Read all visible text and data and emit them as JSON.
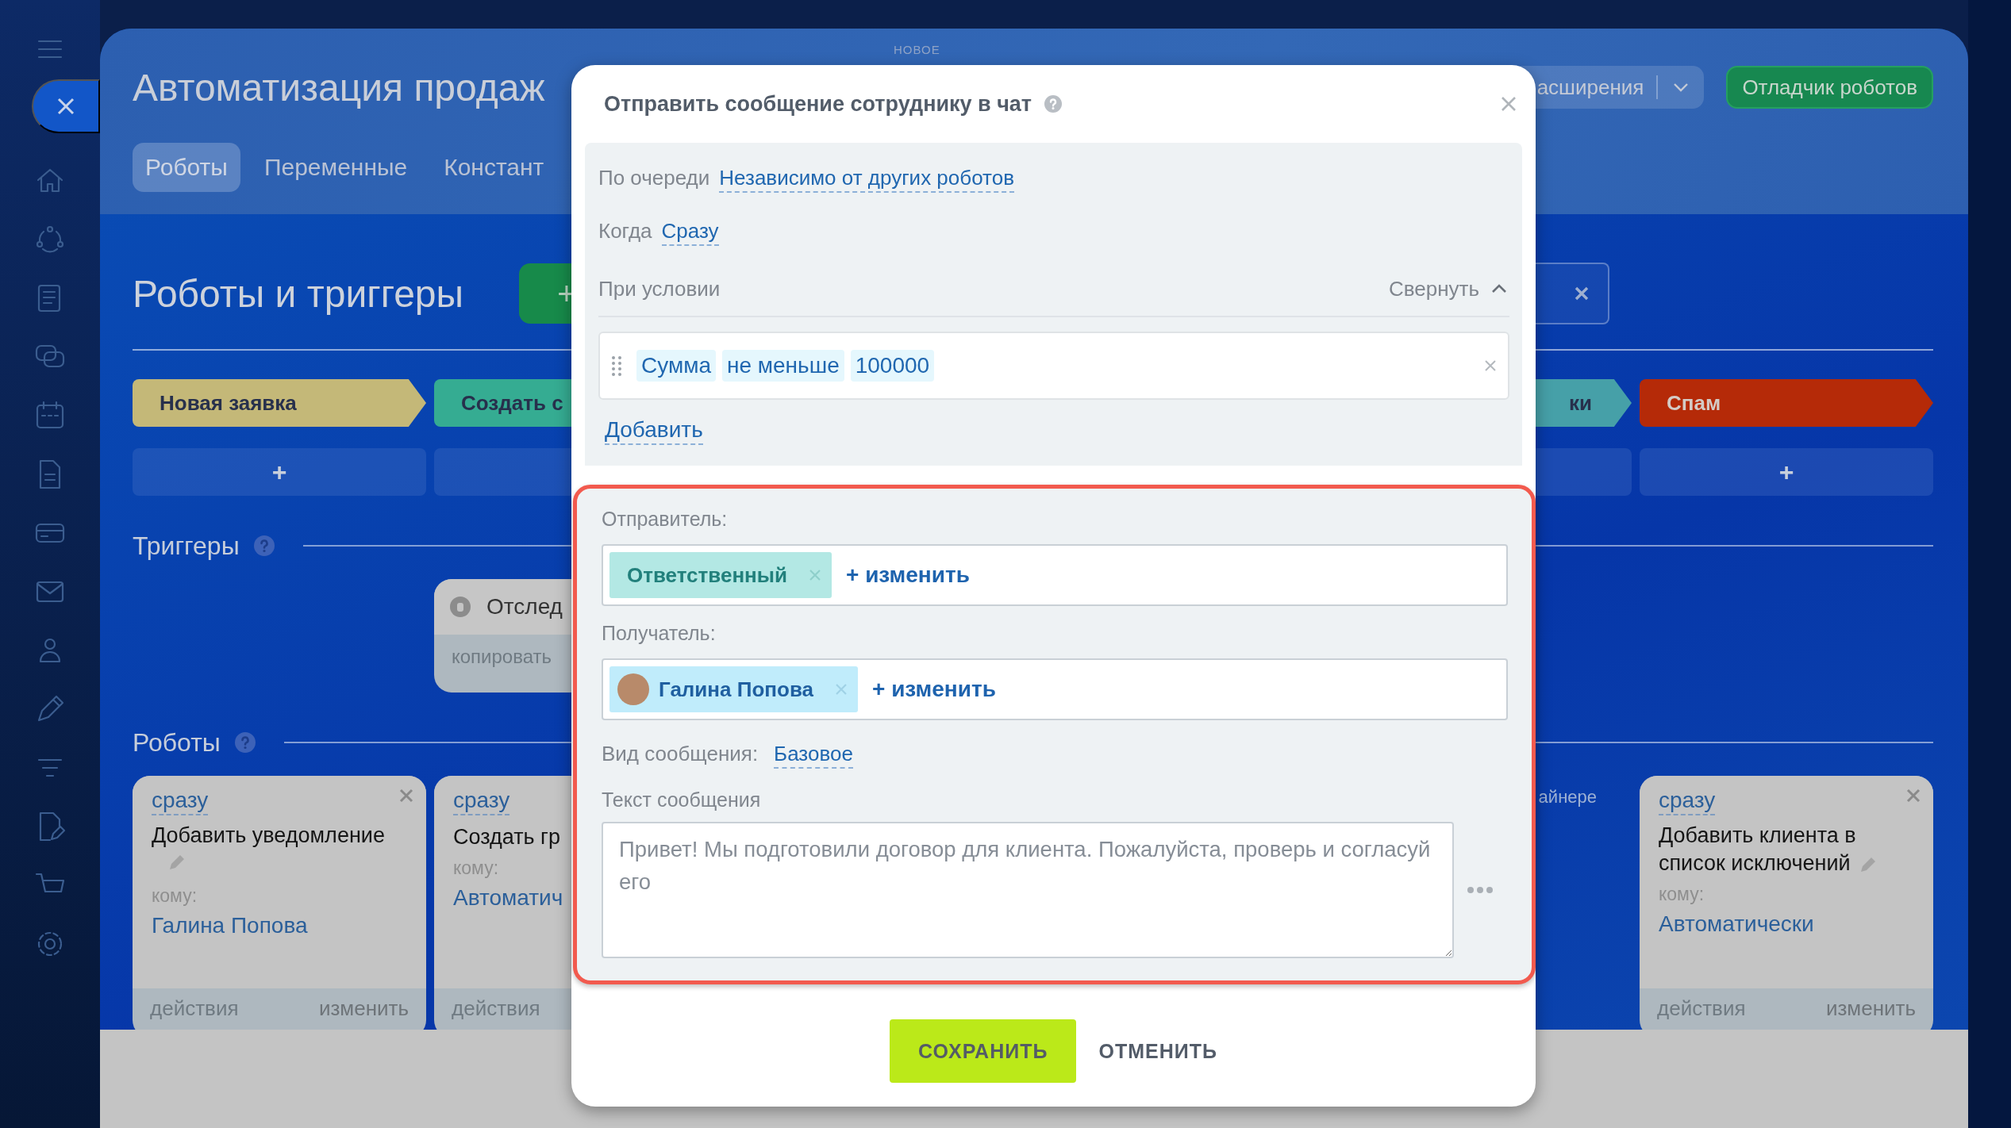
{
  "top_label": "НОВОЕ",
  "header": {
    "title": "Автоматизация продаж",
    "tabs": [
      {
        "label": "Роботы",
        "selected": true
      },
      {
        "label": "Переменные",
        "selected": false
      },
      {
        "label": "Констант",
        "selected": false
      }
    ],
    "extensions_label": "асширения",
    "debugger_button": "Отладчик роботов"
  },
  "section": {
    "title": "Роботы и триггеры",
    "add_button": "+"
  },
  "stages": [
    {
      "label": "Новая заявка",
      "color": "#c4b878"
    },
    {
      "label": "Создать с",
      "color": "#35ac92"
    },
    {
      "label": "ки",
      "color": "#46a0a8"
    },
    {
      "label": "Спам",
      "color": "#b52a08"
    }
  ],
  "add_cells": [
    {
      "kind": "add",
      "label": "+"
    },
    {
      "kind": "blank"
    },
    {
      "kind": "blank"
    },
    {
      "kind": "add",
      "label": "+"
    }
  ],
  "triggers": {
    "title": "Триггеры",
    "cards": [
      {
        "title": "Отслед",
        "action": "копировать"
      }
    ]
  },
  "robots": {
    "title": "Роботы",
    "columns": [
      {
        "kind": "card",
        "when": "сразу",
        "title": "Добавить уведомление",
        "to_label": "кому:",
        "to": "Галина Попова",
        "footer_left": "действия",
        "footer_right": "изменить"
      },
      {
        "kind": "card",
        "when": "сразу",
        "title": "Создать гр",
        "to_label": "кому:",
        "to": "Автоматич",
        "footer_left": "действия"
      },
      {
        "kind": "note",
        "text": "айнере"
      },
      {
        "kind": "card",
        "when": "сразу",
        "title": "Добавить клиента в список исключений",
        "to_label": "кому:",
        "to": "Автоматически",
        "footer_left": "действия",
        "footer_right": "изменить"
      }
    ]
  },
  "dialog": {
    "title": "Отправить сообщение сотруднику в чат",
    "order_label": "По очереди",
    "order_value": "Независимо от других роботов",
    "when_label": "Когда",
    "when_value": "Сразу",
    "condition_label": "При условии",
    "collapse_link": "Свернуть",
    "condition": [
      "Сумма",
      "не меньше",
      "100000"
    ],
    "add_link": "Добавить",
    "sender_label": "Отправитель:",
    "sender": {
      "kind": "role",
      "chip": "Ответственный",
      "change": "+ изменить"
    },
    "recipient_label": "Получатель:",
    "recipient": {
      "kind": "user",
      "chip": "Галина Попова",
      "change": "+ изменить"
    },
    "message_type_label": "Вид сообщения:",
    "message_type": "Базовое",
    "message_label": "Текст сообщения",
    "message": "Привет! Мы подготовили договор для клиента. Пожалуйста, проверь и согласуй его",
    "buttons": [
      {
        "label": "СОХРАНИТЬ",
        "kind": "primary"
      },
      {
        "label": "ОТМЕНИТЬ",
        "kind": "secondary"
      }
    ]
  }
}
